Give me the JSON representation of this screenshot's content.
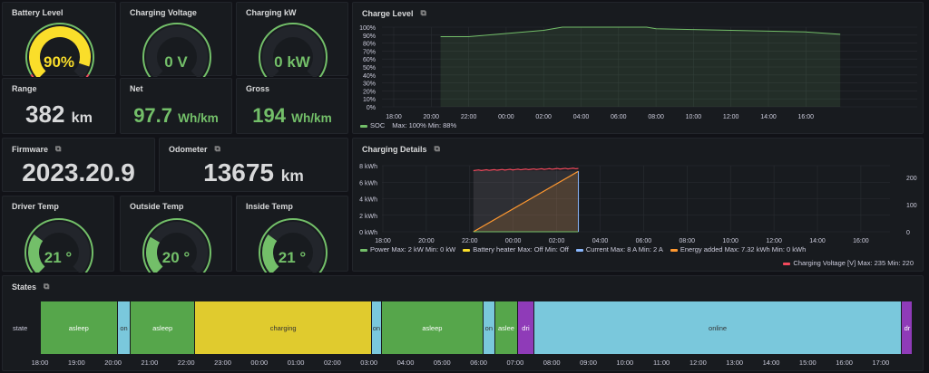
{
  "colors": {
    "green": "#73bf69",
    "yellow": "#fade2a",
    "red": "#f2495c",
    "orange": "#ff9830",
    "blue": "#8ab8ff",
    "cyan": "#7ac8dc",
    "purple": "#8f3bb8",
    "state_green": "#56a64b",
    "state_yellow": "#e0cb2e"
  },
  "gauges": [
    {
      "title": "Battery Level",
      "value": "90%",
      "fraction": 0.9,
      "color": "#fade2a"
    },
    {
      "title": "Charging Voltage",
      "value": "0 V",
      "fraction": 0,
      "color": "#73bf69"
    },
    {
      "title": "Charging kW",
      "value": "0 kW",
      "fraction": 0,
      "color": "#73bf69"
    },
    {
      "title": "Driver Temp",
      "value": "21 °",
      "fraction": 0.3,
      "color": "#73bf69"
    },
    {
      "title": "Outside Temp",
      "value": "20 °",
      "fraction": 0.28,
      "color": "#73bf69"
    },
    {
      "title": "Inside Temp",
      "value": "21 °",
      "fraction": 0.3,
      "color": "#73bf69"
    }
  ],
  "stats": {
    "range": {
      "title": "Range",
      "value": "382",
      "unit": "km"
    },
    "net": {
      "title": "Net",
      "value": "97.7",
      "unit": "Wh/km"
    },
    "gross": {
      "title": "Gross",
      "value": "194",
      "unit": "Wh/km"
    },
    "firmware": {
      "title": "Firmware",
      "value": "2023.20.9"
    },
    "odometer": {
      "title": "Odometer",
      "value": "13675",
      "unit": "km"
    }
  },
  "chart_data": [
    {
      "type": "area",
      "title": "Charge Level",
      "x_ticks": [
        "18:00",
        "20:00",
        "22:00",
        "00:00",
        "02:00",
        "04:00",
        "06:00",
        "08:00",
        "10:00",
        "12:00",
        "14:00",
        "16:00"
      ],
      "y_ticks": [
        "0%",
        "10%",
        "20%",
        "30%",
        "40%",
        "50%",
        "60%",
        "70%",
        "80%",
        "90%",
        "100%"
      ],
      "ylim": [
        0,
        100
      ],
      "series": [
        {
          "name": "SOC",
          "x": [
            "20:30",
            "22:00",
            "00:00",
            "02:00",
            "03:00",
            "07:30",
            "08:00",
            "10:00",
            "12:00",
            "14:00",
            "16:00",
            "17:50"
          ],
          "values": [
            88,
            88,
            92,
            96,
            100,
            100,
            98,
            97,
            96,
            95,
            94,
            91
          ]
        }
      ],
      "legend": {
        "name": "SOC",
        "stats": "Max: 100%  Min: 88%"
      }
    },
    {
      "type": "line",
      "title": "Charging Details",
      "x_ticks": [
        "18:00",
        "20:00",
        "22:00",
        "00:00",
        "02:00",
        "04:00",
        "06:00",
        "08:00",
        "10:00",
        "12:00",
        "14:00",
        "16:00"
      ],
      "y_ticks": [
        "0 kWh",
        "2 kWh",
        "4 kWh",
        "6 kWh",
        "8 kWh"
      ],
      "y2_ticks": [
        "0",
        "100",
        "200"
      ],
      "ylim": [
        0,
        8
      ],
      "y2lim": [
        0,
        245
      ],
      "charge_window": [
        "22:10",
        "03:00"
      ],
      "series": [
        {
          "name": "Energy added",
          "x": [
            "22:10",
            "03:00"
          ],
          "values": [
            0,
            7.32
          ]
        },
        {
          "name": "Charging Voltage [V]",
          "axis": "right",
          "x": [
            "22:10",
            "03:00"
          ],
          "values": [
            225,
            232
          ]
        }
      ],
      "legend": [
        {
          "name": "Power",
          "stats": "Max: 2 kW  Min: 0 kW",
          "color": "#73bf69"
        },
        {
          "name": "Battery heater",
          "stats": "Max: Off  Min: Off",
          "color": "#fade2a"
        },
        {
          "name": "Current",
          "stats": "Max: 8 A  Min: 2 A",
          "color": "#8ab8ff"
        },
        {
          "name": "Energy added",
          "stats": "Max: 7.32 kWh  Min: 0 kWh",
          "color": "#ff9830"
        },
        {
          "name": "Charging Voltage [V]",
          "stats": "Max: 235  Min: 220",
          "color": "#f2495c"
        }
      ]
    },
    {
      "type": "state-timeline",
      "title": "States",
      "row_label": "state",
      "x_ticks": [
        "18:00",
        "19:00",
        "20:00",
        "21:00",
        "22:00",
        "23:00",
        "00:00",
        "01:00",
        "02:00",
        "03:00",
        "04:00",
        "05:00",
        "06:00",
        "07:00",
        "08:00",
        "09:00",
        "10:00",
        "11:00",
        "12:00",
        "13:00",
        "14:00",
        "15:00",
        "16:00",
        "17:00"
      ],
      "segments": [
        {
          "label": "",
          "start": "17:56",
          "end": "18:01",
          "color": "#7ac8dc"
        },
        {
          "label": "asleep",
          "start": "18:01",
          "end": "20:08",
          "color": "#56a64b"
        },
        {
          "label": "on",
          "start": "20:08",
          "end": "20:29",
          "color": "#7ac8dc"
        },
        {
          "label": "asleep",
          "start": "20:29",
          "end": "22:15",
          "color": "#56a64b"
        },
        {
          "label": "charging",
          "start": "22:15",
          "end": "03:05",
          "color": "#e0cb2e"
        },
        {
          "label": "on",
          "start": "03:05",
          "end": "03:21",
          "color": "#7ac8dc"
        },
        {
          "label": "asleep",
          "start": "03:21",
          "end": "06:08",
          "color": "#56a64b"
        },
        {
          "label": "on",
          "start": "06:08",
          "end": "06:27",
          "color": "#7ac8dc"
        },
        {
          "label": "aslee",
          "start": "06:27",
          "end": "07:05",
          "color": "#56a64b"
        },
        {
          "label": "dri",
          "start": "07:05",
          "end": "07:31",
          "color": "#8f3bb8"
        },
        {
          "label": "online",
          "start": "07:31",
          "end": "17:35",
          "color": "#7ac8dc"
        },
        {
          "label": "dr",
          "start": "17:35",
          "end": "17:53",
          "color": "#8f3bb8"
        }
      ]
    }
  ]
}
